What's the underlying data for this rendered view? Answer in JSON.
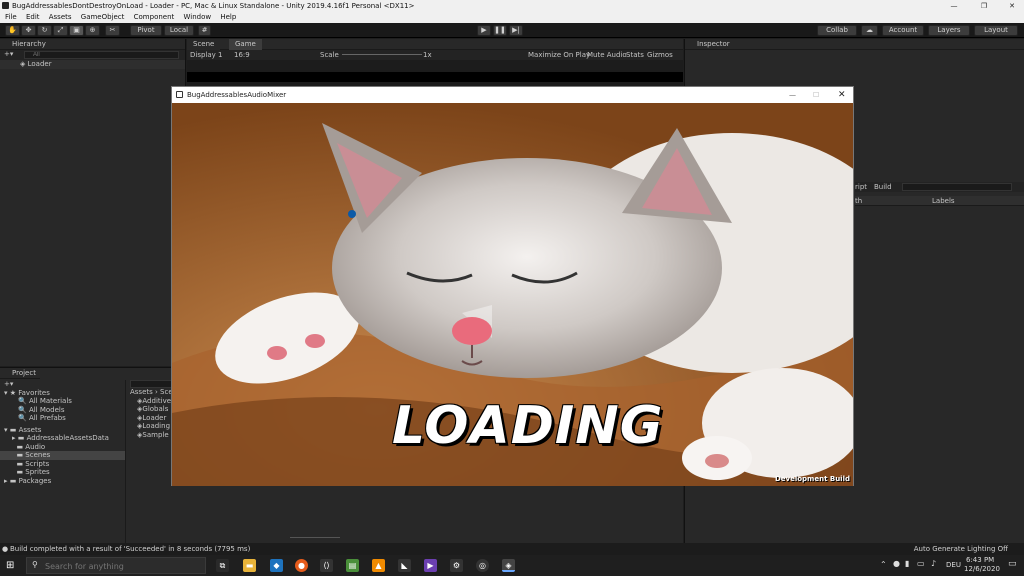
{
  "window": {
    "title": "BugAddressablesDontDestroyOnLoad - Loader - PC, Mac & Linux Standalone - Unity 2019.4.16f1 Personal <DX11>",
    "min_glyph": "—",
    "max_glyph": "❐",
    "close_glyph": "✕"
  },
  "menu": [
    "File",
    "Edit",
    "Assets",
    "GameObject",
    "Component",
    "Window",
    "Help"
  ],
  "toolbar": {
    "pivot": "Pivot",
    "local": "Local",
    "collab": "Collab",
    "account": "Account",
    "layers": "Layers",
    "layout": "Layout"
  },
  "hierarchy": {
    "title": "Hierarchy",
    "search_placeholder": "All",
    "items": [
      "Loader"
    ]
  },
  "scene_tabs": {
    "scene": "Scene",
    "game": "Game",
    "display": "Display 1",
    "aspect": "16:9",
    "scale_label": "Scale",
    "scale_value": "1x",
    "max_on_play": "Maximize On Play",
    "mute_audio": "Mute Audio",
    "stats": "Stats",
    "gizmos": "Gizmos"
  },
  "inspector": {
    "title": "Inspector",
    "script_label": "ript",
    "build_label": "Build",
    "col_path": "th",
    "col_labels": "Labels"
  },
  "project": {
    "title": "Project",
    "favorites_header": "Favorites",
    "favorites": [
      "All Materials",
      "All Models",
      "All Prefabs"
    ],
    "assets_header": "Assets",
    "assets": [
      "AddressableAssetsData",
      "Audio",
      "Scenes",
      "Scripts",
      "Sprites"
    ],
    "packages_header": "Packages",
    "breadcrumb": "Assets",
    "breadcrumb2": "Sce",
    "files": [
      "Additive",
      "Globals",
      "Loader",
      "Loading",
      "Sample"
    ]
  },
  "game_window": {
    "title": "BugAddressablesAudioMixer",
    "loading_text": "LOADING",
    "dev_build": "Development Build"
  },
  "status": {
    "message": "Build completed with a result of 'Succeeded' in 8 seconds (7795 ms)",
    "right": "Auto Generate Lighting Off"
  },
  "taskbar": {
    "search_placeholder": "Search for anything",
    "lang": "DEU",
    "time": "6:43 PM",
    "date": "12/6/2020"
  },
  "colors": {
    "selection": "#2c5d87",
    "unity_bg": "#1e1e1e"
  }
}
